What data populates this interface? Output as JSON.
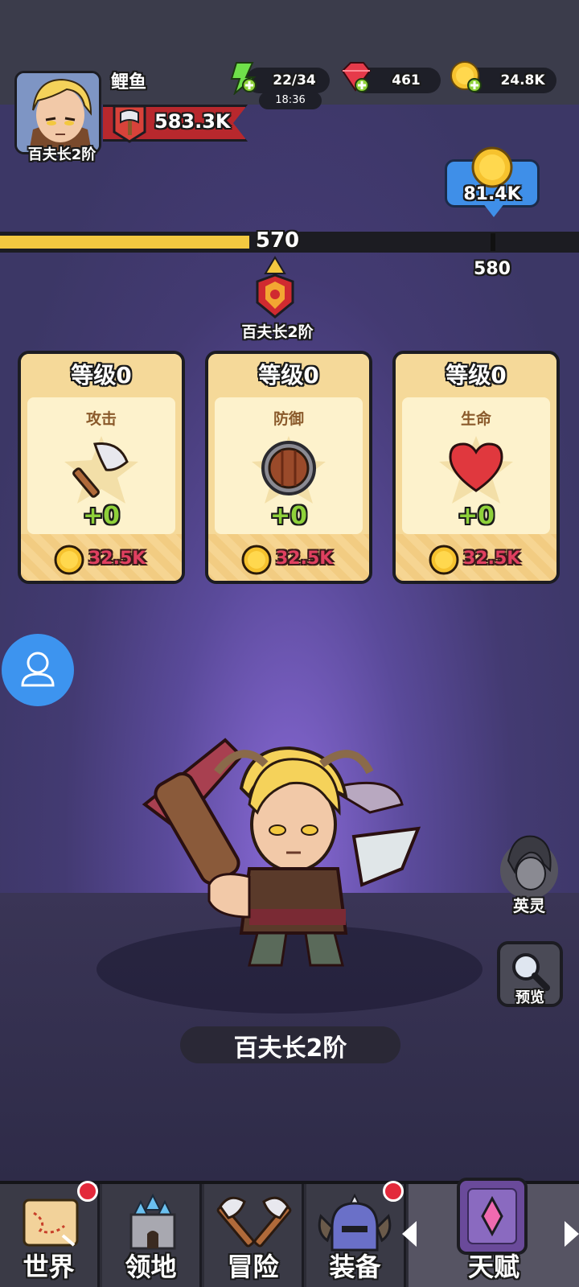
{
  "player": {
    "name": "鲤鱼",
    "rank_title": "百夫长2阶",
    "power": "583.3K"
  },
  "resources": {
    "stamina": "22/34",
    "stamina_timer": "18:36",
    "gems": "461",
    "gold": "24.8K"
  },
  "gold_bubble": "81.4K",
  "progress": {
    "current": "570",
    "next": "580",
    "fill_fraction": 0.43,
    "rank_label": "百夫长2阶"
  },
  "cards": [
    {
      "level": "等级0",
      "stat": "攻击",
      "bonus": "+0",
      "cost": "32.5K",
      "icon": "axe-icon"
    },
    {
      "level": "等级0",
      "stat": "防御",
      "bonus": "+0",
      "cost": "32.5K",
      "icon": "shield-icon"
    },
    {
      "level": "等级0",
      "stat": "生命",
      "bonus": "+0",
      "cost": "32.5K",
      "icon": "heart-icon"
    }
  ],
  "side": {
    "hero_spirit": "英灵",
    "preview": "预览"
  },
  "hero_name": "百夫长2阶",
  "nav": [
    {
      "label": "世界",
      "icon": "map-scroll-icon",
      "badge": true
    },
    {
      "label": "领地",
      "icon": "castle-icon",
      "badge": false
    },
    {
      "label": "冒险",
      "icon": "crossed-axes-icon",
      "badge": false
    },
    {
      "label": "装备",
      "icon": "helmet-icon",
      "badge": true
    },
    {
      "label": "天赋",
      "icon": "talent-book-icon",
      "badge": false
    }
  ],
  "colors": {
    "accent_gold": "#f3c840",
    "card_bg": "#f5d999",
    "cost_red": "#e04060",
    "bonus_green": "#8fd13a",
    "bubble_blue": "#3f8fe8"
  }
}
